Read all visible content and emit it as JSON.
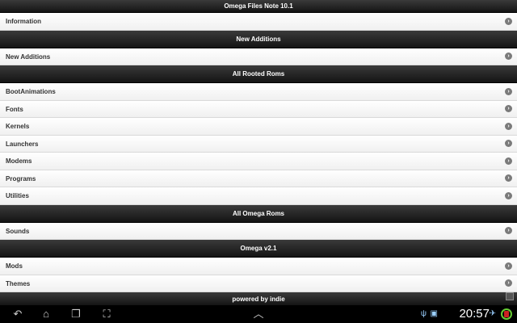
{
  "title": "Omega Files Note 10.1",
  "items": [
    {
      "type": "item",
      "label": "Information"
    },
    {
      "type": "header",
      "label": "New Additions"
    },
    {
      "type": "item",
      "label": "New Additions"
    },
    {
      "type": "header",
      "label": "All Rooted Roms"
    },
    {
      "type": "item",
      "label": "BootAnimations"
    },
    {
      "type": "item",
      "label": "Fonts"
    },
    {
      "type": "item",
      "label": "Kernels"
    },
    {
      "type": "item",
      "label": "Launchers"
    },
    {
      "type": "item",
      "label": "Modems"
    },
    {
      "type": "item",
      "label": "Programs"
    },
    {
      "type": "item",
      "label": "Utilities"
    },
    {
      "type": "header",
      "label": "All Omega Roms"
    },
    {
      "type": "item",
      "label": "Sounds"
    },
    {
      "type": "header",
      "label": "Omega v2.1"
    },
    {
      "type": "item",
      "label": "Mods"
    },
    {
      "type": "item",
      "label": "Themes"
    }
  ],
  "footer": "powered by indie",
  "status": {
    "time": "20:57"
  },
  "icons": {
    "back": "back-arrow-icon",
    "home": "home-icon",
    "recent": "recent-apps-icon",
    "screenshot": "screenshot-icon",
    "up": "chevron-up-icon",
    "usb": "usb-icon",
    "image": "image-icon",
    "airplane": "airplane-icon",
    "signal": "signal-icon",
    "battery": "battery-icon",
    "chevron": "chevron-right-icon"
  }
}
